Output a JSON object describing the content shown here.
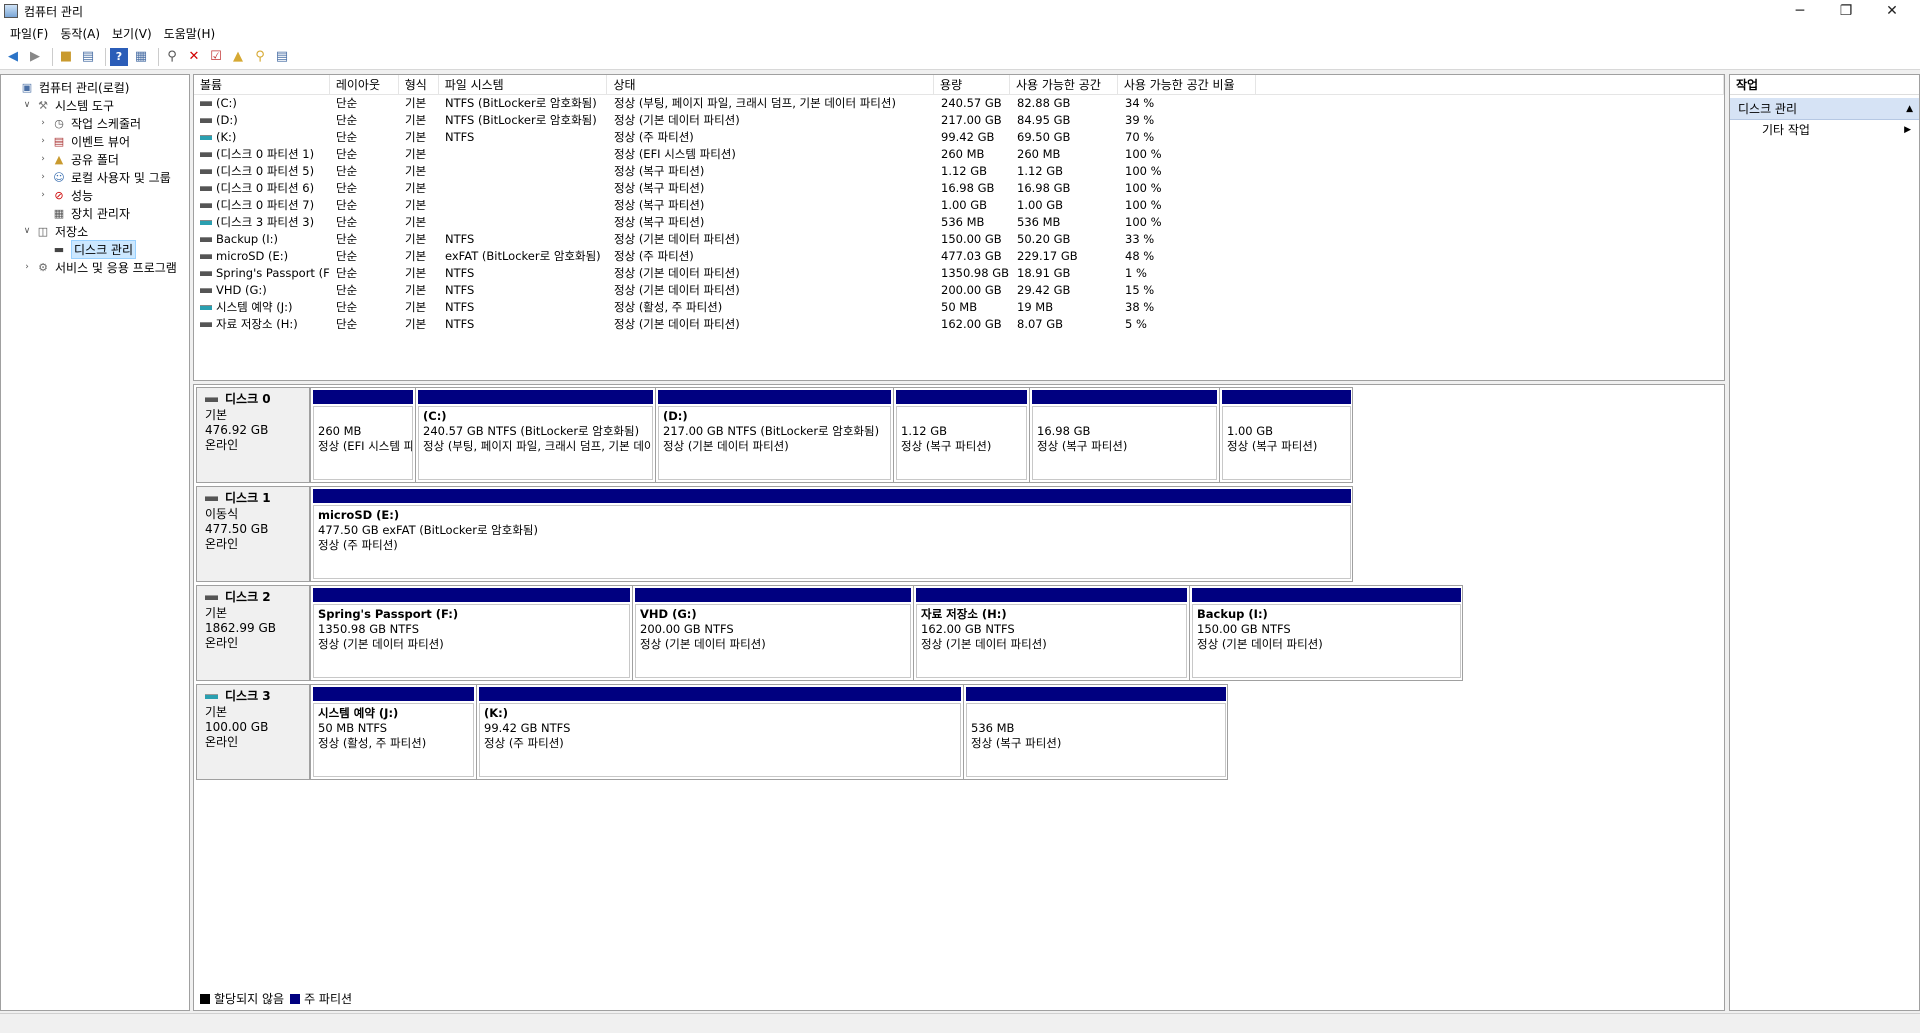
{
  "window": {
    "title": "컴퓨터 관리",
    "min_glyph": "─",
    "max_glyph": "❐",
    "close_glyph": "✕"
  },
  "menu": [
    "파일(F)",
    "동작(A)",
    "보기(V)",
    "도움말(H)"
  ],
  "toolbar_icons": [
    "back-icon",
    "forward-icon",
    "up-icon",
    "show-hide-tree-icon",
    "help-icon",
    "properties-icon",
    "connect-icon",
    "delete-icon",
    "check-icon",
    "folder-icon",
    "search-icon",
    "detail-icon"
  ],
  "tree": [
    {
      "label": "컴퓨터 관리(로컬)",
      "indent": 0,
      "expander": "",
      "icon": "computer-icon"
    },
    {
      "label": "시스템 도구",
      "indent": 1,
      "expander": "v",
      "icon": "tools-icon"
    },
    {
      "label": "작업 스케줄러",
      "indent": 2,
      "expander": ">",
      "icon": "clock-icon"
    },
    {
      "label": "이벤트 뷰어",
      "indent": 2,
      "expander": ">",
      "icon": "event-viewer-icon"
    },
    {
      "label": "공유 폴더",
      "indent": 2,
      "expander": ">",
      "icon": "shared-folder-icon"
    },
    {
      "label": "로컬 사용자 및 그룹",
      "indent": 2,
      "expander": ">",
      "icon": "users-icon"
    },
    {
      "label": "성능",
      "indent": 2,
      "expander": ">",
      "icon": "performance-icon"
    },
    {
      "label": "장치 관리자",
      "indent": 2,
      "expander": "",
      "icon": "device-manager-icon"
    },
    {
      "label": "저장소",
      "indent": 1,
      "expander": "v",
      "icon": "storage-icon"
    },
    {
      "label": "디스크 관리",
      "indent": 2,
      "expander": "",
      "icon": "disk-management-icon",
      "selected": true
    },
    {
      "label": "서비스 및 응용 프로그램",
      "indent": 1,
      "expander": ">",
      "icon": "services-icon"
    }
  ],
  "volumes": {
    "headers": [
      "볼륨",
      "레이아웃",
      "형식",
      "파일 시스템",
      "상태",
      "용량",
      "사용 가능한 공간",
      "사용 가능한 공간 비율",
      ""
    ],
    "rows": [
      {
        "icon": "gray",
        "name": "(C:)",
        "layout": "단순",
        "type": "기본",
        "fs": "NTFS (BitLocker로 암호화됨)",
        "status": "정상 (부팅, 페이지 파일, 크래시 덤프, 기본 데이터 파티션)",
        "capacity": "240.57 GB",
        "free": "82.88 GB",
        "pct": "34 %"
      },
      {
        "icon": "gray",
        "name": "(D:)",
        "layout": "단순",
        "type": "기본",
        "fs": "NTFS (BitLocker로 암호화됨)",
        "status": "정상 (기본 데이터 파티션)",
        "capacity": "217.00 GB",
        "free": "84.95 GB",
        "pct": "39 %"
      },
      {
        "icon": "teal",
        "name": "(K:)",
        "layout": "단순",
        "type": "기본",
        "fs": "NTFS",
        "status": "정상 (주 파티션)",
        "capacity": "99.42 GB",
        "free": "69.50 GB",
        "pct": "70 %"
      },
      {
        "icon": "gray",
        "name": "(디스크 0 파티션 1)",
        "layout": "단순",
        "type": "기본",
        "fs": "",
        "status": "정상 (EFI 시스템 파티션)",
        "capacity": "260 MB",
        "free": "260 MB",
        "pct": "100 %"
      },
      {
        "icon": "gray",
        "name": "(디스크 0 파티션 5)",
        "layout": "단순",
        "type": "기본",
        "fs": "",
        "status": "정상 (복구 파티션)",
        "capacity": "1.12 GB",
        "free": "1.12 GB",
        "pct": "100 %"
      },
      {
        "icon": "gray",
        "name": "(디스크 0 파티션 6)",
        "layout": "단순",
        "type": "기본",
        "fs": "",
        "status": "정상 (복구 파티션)",
        "capacity": "16.98 GB",
        "free": "16.98 GB",
        "pct": "100 %"
      },
      {
        "icon": "gray",
        "name": "(디스크 0 파티션 7)",
        "layout": "단순",
        "type": "기본",
        "fs": "",
        "status": "정상 (복구 파티션)",
        "capacity": "1.00 GB",
        "free": "1.00 GB",
        "pct": "100 %"
      },
      {
        "icon": "teal",
        "name": "(디스크 3 파티션 3)",
        "layout": "단순",
        "type": "기본",
        "fs": "",
        "status": "정상 (복구 파티션)",
        "capacity": "536 MB",
        "free": "536 MB",
        "pct": "100 %"
      },
      {
        "icon": "gray",
        "name": "Backup (I:)",
        "layout": "단순",
        "type": "기본",
        "fs": "NTFS",
        "status": "정상 (기본 데이터 파티션)",
        "capacity": "150.00 GB",
        "free": "50.20 GB",
        "pct": "33 %"
      },
      {
        "icon": "gray",
        "name": "microSD (E:)",
        "layout": "단순",
        "type": "기본",
        "fs": "exFAT (BitLocker로 암호화됨)",
        "status": "정상 (주 파티션)",
        "capacity": "477.03 GB",
        "free": "229.17 GB",
        "pct": "48 %"
      },
      {
        "icon": "gray",
        "name": "Spring's Passport (F:)",
        "layout": "단순",
        "type": "기본",
        "fs": "NTFS",
        "status": "정상 (기본 데이터 파티션)",
        "capacity": "1350.98 GB",
        "free": "18.91 GB",
        "pct": "1 %"
      },
      {
        "icon": "gray",
        "name": "VHD (G:)",
        "layout": "단순",
        "type": "기본",
        "fs": "NTFS",
        "status": "정상 (기본 데이터 파티션)",
        "capacity": "200.00 GB",
        "free": "29.42 GB",
        "pct": "15 %"
      },
      {
        "icon": "teal",
        "name": "시스템 예약 (J:)",
        "layout": "단순",
        "type": "기본",
        "fs": "NTFS",
        "status": "정상 (활성, 주 파티션)",
        "capacity": "50 MB",
        "free": "19 MB",
        "pct": "38 %"
      },
      {
        "icon": "gray",
        "name": "자료 저장소 (H:)",
        "layout": "단순",
        "type": "기본",
        "fs": "NTFS",
        "status": "정상 (기본 데이터 파티션)",
        "capacity": "162.00 GB",
        "free": "8.07 GB",
        "pct": "5 %"
      }
    ]
  },
  "disks": [
    {
      "name": "디스크 0",
      "icon": "gray",
      "type": "기본",
      "size": "476.92 GB",
      "state": "온라인",
      "partitions": [
        {
          "title": "",
          "line1": "260 MB",
          "line2": "정상 (EFI 시스템 파티션)"
        },
        {
          "title": "(C:)",
          "line1": "240.57 GB NTFS (BitLocker로 암호화됨)",
          "line2": "정상 (부팅, 페이지 파일, 크래시 덤프, 기본 데이터 파티션)"
        },
        {
          "title": "(D:)",
          "line1": "217.00 GB NTFS (BitLocker로 암호화됨)",
          "line2": "정상 (기본 데이터 파티션)"
        },
        {
          "title": "",
          "line1": "1.12 GB",
          "line2": "정상 (복구 파티션)"
        },
        {
          "title": "",
          "line1": "16.98 GB",
          "line2": "정상 (복구 파티션)"
        },
        {
          "title": "",
          "line1": "1.00 GB",
          "line2": "정상 (복구 파티션)"
        }
      ]
    },
    {
      "name": "디스크 1",
      "icon": "gray",
      "type": "이동식",
      "size": "477.50 GB",
      "state": "온라인",
      "partitions": [
        {
          "title": "microSD  (E:)",
          "line1": "477.50 GB exFAT (BitLocker로 암호화됨)",
          "line2": "정상 (주 파티션)"
        }
      ]
    },
    {
      "name": "디스크 2",
      "icon": "gray",
      "type": "기본",
      "size": "1862.99 GB",
      "state": "온라인",
      "partitions": [
        {
          "title": "Spring's Passport  (F:)",
          "line1": "1350.98 GB NTFS",
          "line2": "정상 (기본 데이터 파티션)"
        },
        {
          "title": "VHD  (G:)",
          "line1": "200.00 GB NTFS",
          "line2": "정상 (기본 데이터 파티션)"
        },
        {
          "title": "자료 저장소  (H:)",
          "line1": "162.00 GB NTFS",
          "line2": "정상 (기본 데이터 파티션)"
        },
        {
          "title": "Backup  (I:)",
          "line1": "150.00 GB NTFS",
          "line2": "정상 (기본 데이터 파티션)"
        }
      ]
    },
    {
      "name": "디스크 3",
      "icon": "teal",
      "type": "기본",
      "size": "100.00 GB",
      "state": "온라인",
      "partitions": [
        {
          "title": "시스템 예약  (J:)",
          "line1": "50 MB NTFS",
          "line2": "정상 (활성, 주 파티션)"
        },
        {
          "title": "(K:)",
          "line1": "99.42 GB NTFS",
          "line2": "정상 (주 파티션)"
        },
        {
          "title": "",
          "line1": "536 MB",
          "line2": "정상 (복구 파티션)"
        }
      ]
    }
  ],
  "legend": [
    {
      "label": "할당되지 않음",
      "color": "#000000"
    },
    {
      "label": "주 파티션",
      "color": "#000080"
    }
  ],
  "actions": {
    "header": "작업",
    "section": "디스크 관리",
    "section_glyph": "▲",
    "item": "기타 작업",
    "item_glyph": "▶"
  }
}
